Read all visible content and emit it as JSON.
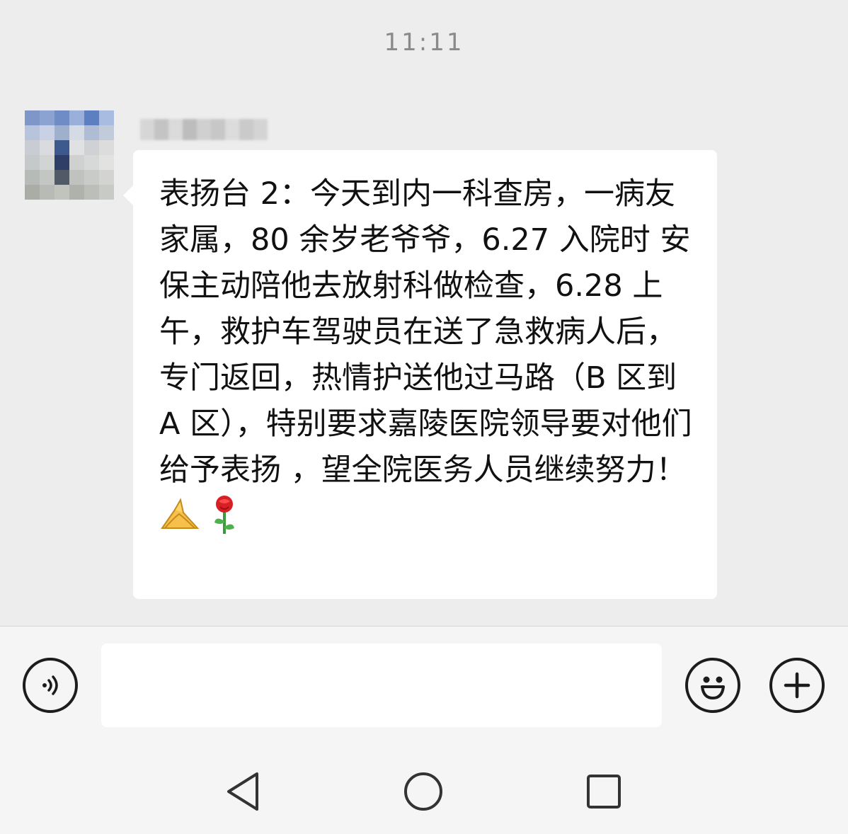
{
  "chat": {
    "timestamp": "11:11",
    "message": {
      "text": "表扬台 2：今天到内一科查房，一病友家属，80 余岁老爷爷，6.27 入院时 安保主动陪他去放射科做检查，6.28 上午，救护车驾驶员在送了急救病人后，专门返回，热情护送他过马路（B 区到 A 区），特别要求嘉陵医院领导要对他们给予表扬 ，望全院医务人员继续努力！",
      "emojis": [
        "praying-hands",
        "rose"
      ]
    }
  },
  "input_bar": {
    "voice_icon": "voice-icon",
    "placeholder": "",
    "emoji_icon": "smiley-face-icon",
    "more_icon": "plus-icon"
  },
  "nav_bar": {
    "back_icon": "back-triangle-icon",
    "home_icon": "home-circle-icon",
    "recents_icon": "recents-square-icon"
  },
  "colors": {
    "chat_background": "#ededed",
    "bubble": "#ffffff",
    "text": "#111111",
    "timestamp": "#8a8a8a",
    "input_bar": "#f5f5f5"
  }
}
